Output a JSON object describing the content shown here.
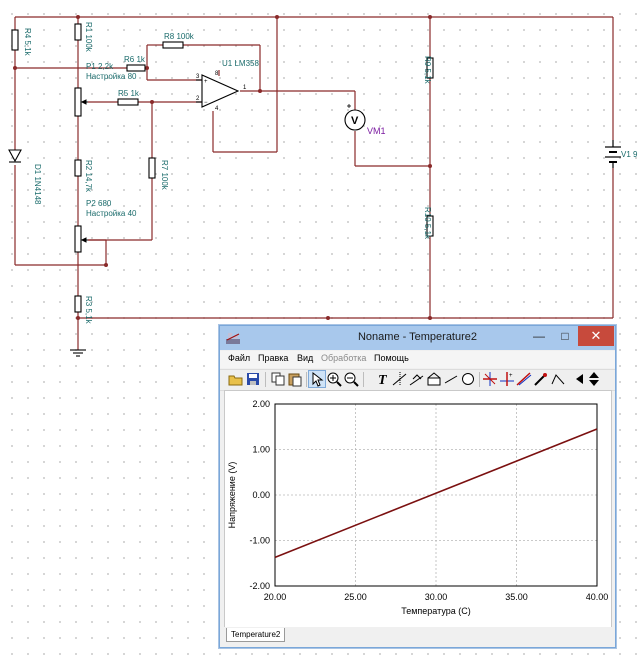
{
  "schematic": {
    "components": [
      {
        "id": "r4",
        "label": "R4 5,1k"
      },
      {
        "id": "r1",
        "label": "R1 100k"
      },
      {
        "id": "r8",
        "label": "R8 100k"
      },
      {
        "id": "u1",
        "label": "U1 LM358"
      },
      {
        "id": "p1",
        "label": "P1 2,2k"
      },
      {
        "id": "p1_set",
        "label": "Настройка 80"
      },
      {
        "id": "r6",
        "label": "R6 1k"
      },
      {
        "id": "r5",
        "label": "R5 1k"
      },
      {
        "id": "r9",
        "label": "R9 5,1k"
      },
      {
        "id": "vm1",
        "label": "VM1"
      },
      {
        "id": "v1",
        "label": "V1 9"
      },
      {
        "id": "d1",
        "label": "D1 1N4148"
      },
      {
        "id": "r2",
        "label": "R2 14,7k"
      },
      {
        "id": "r7",
        "label": "R7 100k"
      },
      {
        "id": "p2",
        "label": "P2 680"
      },
      {
        "id": "p2_set",
        "label": "Настройка 40"
      },
      {
        "id": "r10",
        "label": "R10 5,1k"
      },
      {
        "id": "r3",
        "label": "R3 5,1k"
      }
    ],
    "pins": {
      "plus": "+",
      "minus": "−",
      "p2": "2",
      "p3": "3",
      "p1": "1",
      "p8": "8",
      "p4": "4"
    },
    "voltmeter_symbol": "V"
  },
  "window": {
    "title": "Noname - Temperature2",
    "controls": {
      "minimize": "—",
      "maximize": "□",
      "close": "✕"
    },
    "menu": [
      {
        "label": "Файл",
        "enabled": true
      },
      {
        "label": "Правка",
        "enabled": true
      },
      {
        "label": "Вид",
        "enabled": true
      },
      {
        "label": "Обработка",
        "enabled": false
      },
      {
        "label": "Помощь",
        "enabled": true
      }
    ],
    "toolbar": [
      "open-icon",
      "save-icon",
      "copy-icon",
      "paste-icon",
      "pointer-icon",
      "zoom-in-icon",
      "zoom-out-icon",
      "text-icon",
      "cursor-a-icon",
      "cursor-b-icon",
      "cursor-c-icon",
      "line-icon",
      "ellipse-icon",
      "marker-a-icon",
      "marker-b-icon",
      "marker-c-icon",
      "probe-icon",
      "curve-icon",
      "arrow-left-icon",
      "arrow-updown-icon"
    ],
    "tab": "Temperature2"
  },
  "chart_data": {
    "type": "line",
    "xlabel": "Температура (C)",
    "ylabel": "Напряжение (V)",
    "xlim": [
      20,
      40
    ],
    "ylim": [
      -2,
      2
    ],
    "x_ticks": [
      "20.00",
      "25.00",
      "30.00",
      "35.00",
      "40.00"
    ],
    "y_ticks": [
      "2.00",
      "1.00",
      "0.00",
      "-1.00",
      "-2.00"
    ],
    "grid": true,
    "series": [
      {
        "color": "#7b1010",
        "x": [
          20,
          40
        ],
        "y": [
          -1.37,
          1.45
        ]
      }
    ]
  },
  "colors": {
    "wire": "#8a2a2a",
    "component": "#000000",
    "label": "#1a6b6b",
    "meter_label": "#7a1aa0",
    "close_button": "#c74a3c",
    "title_bar": "#a8c8ec"
  }
}
